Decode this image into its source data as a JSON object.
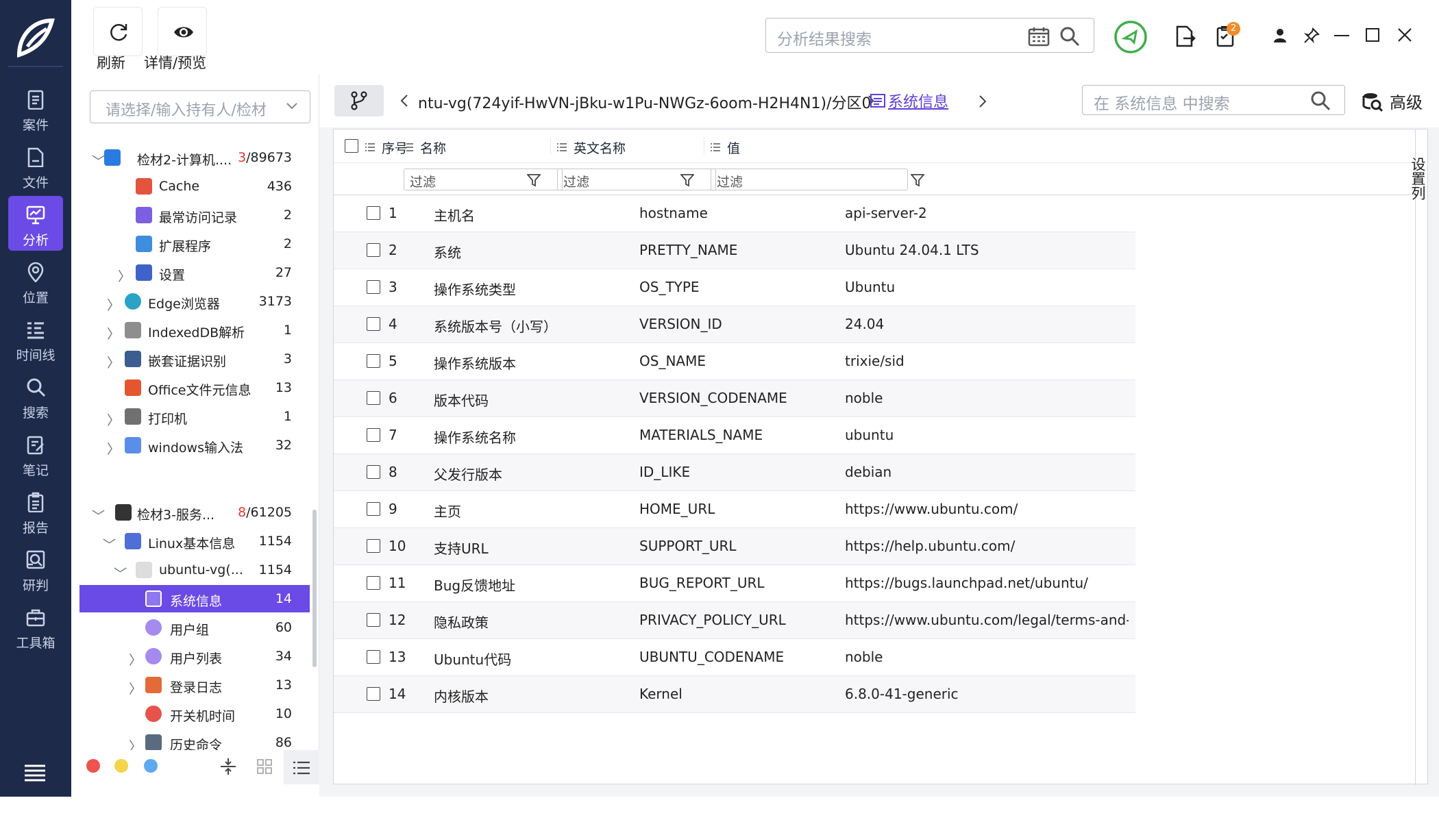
{
  "nav": {
    "items": [
      {
        "label": "案件",
        "icon": "case-icon"
      },
      {
        "label": "文件",
        "icon": "file-icon"
      },
      {
        "label": "分析",
        "icon": "analysis-icon",
        "active": true
      },
      {
        "label": "位置",
        "icon": "location-icon"
      },
      {
        "label": "时间线",
        "icon": "timeline-icon"
      },
      {
        "label": "搜索",
        "icon": "search-icon"
      },
      {
        "label": "笔记",
        "icon": "note-icon"
      },
      {
        "label": "报告",
        "icon": "report-icon"
      },
      {
        "label": "研判",
        "icon": "judge-icon"
      },
      {
        "label": "工具箱",
        "icon": "toolbox-icon"
      }
    ]
  },
  "toolbar": {
    "refresh_label": "刷新",
    "preview_label": "详情/预览"
  },
  "top": {
    "search_placeholder": "分析结果搜索",
    "badge": "2"
  },
  "sidebar": {
    "owner_placeholder": "请选择/输入持有人/检材",
    "nodes": [
      {
        "label": "检材2-计算机....",
        "count_red": "3",
        "count": "/89673"
      },
      {
        "label": "Cache",
        "count": "436"
      },
      {
        "label": "最常访问记录",
        "count": "2"
      },
      {
        "label": "扩展程序",
        "count": "2"
      },
      {
        "label": "设置",
        "count": "27"
      },
      {
        "label": "Edge浏览器",
        "count": "3173"
      },
      {
        "label": "IndexedDB解析",
        "count": "1"
      },
      {
        "label": "嵌套证据识别",
        "count": "3"
      },
      {
        "label": "Office文件元信息",
        "count": "13"
      },
      {
        "label": "打印机",
        "count": "1"
      },
      {
        "label": "windows输入法",
        "count": "32"
      },
      {
        "label": "检材3-服务...",
        "count_red": "8",
        "count": "/61205"
      },
      {
        "label": "Linux基本信息",
        "count": "1154"
      },
      {
        "label": "ubuntu-vg(...",
        "count": "1154"
      },
      {
        "label": "系统信息",
        "count": "14"
      },
      {
        "label": "用户组",
        "count": "60"
      },
      {
        "label": "用户列表",
        "count": "34"
      },
      {
        "label": "登录日志",
        "count": "13"
      },
      {
        "label": "开关机时间",
        "count": "10"
      },
      {
        "label": "历史命令",
        "count": "86"
      }
    ]
  },
  "crumb": {
    "path": "ntu-vg(724yif-HwVN-jBku-w1Pu-NWGz-6oom-H2H4N1)/分区0",
    "current": "系统信息"
  },
  "panel": {
    "search_placeholder": "在 系统信息 中搜索",
    "advanced_label": "高级",
    "column_settings": "设置列"
  },
  "table": {
    "headers": {
      "index": "序号",
      "name": "名称",
      "en_name": "英文名称",
      "value": "值"
    },
    "filter_placeholder": "过滤",
    "rows": [
      {
        "no": "1",
        "name": "主机名",
        "en": "hostname",
        "value": "api-server-2"
      },
      {
        "no": "2",
        "name": "系统",
        "en": "PRETTY_NAME",
        "value": "Ubuntu 24.04.1 LTS"
      },
      {
        "no": "3",
        "name": "操作系统类型",
        "en": "OS_TYPE",
        "value": "Ubuntu"
      },
      {
        "no": "4",
        "name": "系统版本号（小写）",
        "en": "VERSION_ID",
        "value": "24.04"
      },
      {
        "no": "5",
        "name": "操作系统版本",
        "en": "OS_NAME",
        "value": "trixie/sid"
      },
      {
        "no": "6",
        "name": "版本代码",
        "en": "VERSION_CODENAME",
        "value": "noble"
      },
      {
        "no": "7",
        "name": "操作系统名称",
        "en": "MATERIALS_NAME",
        "value": "ubuntu"
      },
      {
        "no": "8",
        "name": "父发行版本",
        "en": "ID_LIKE",
        "value": "debian"
      },
      {
        "no": "9",
        "name": "主页",
        "en": "HOME_URL",
        "value": "https://www.ubuntu.com/"
      },
      {
        "no": "10",
        "name": "支持URL",
        "en": "SUPPORT_URL",
        "value": "https://help.ubuntu.com/"
      },
      {
        "no": "11",
        "name": "Bug反馈地址",
        "en": "BUG_REPORT_URL",
        "value": "https://bugs.launchpad.net/ubuntu/"
      },
      {
        "no": "12",
        "name": "隐私政策",
        "en": "PRIVACY_POLICY_URL",
        "value": "https://www.ubuntu.com/legal/terms-and-..."
      },
      {
        "no": "13",
        "name": "Ubuntu代码",
        "en": "UBUNTU_CODENAME",
        "value": "noble"
      },
      {
        "no": "14",
        "name": "内核版本",
        "en": "Kernel",
        "value": "6.8.0-41-generic"
      }
    ]
  }
}
